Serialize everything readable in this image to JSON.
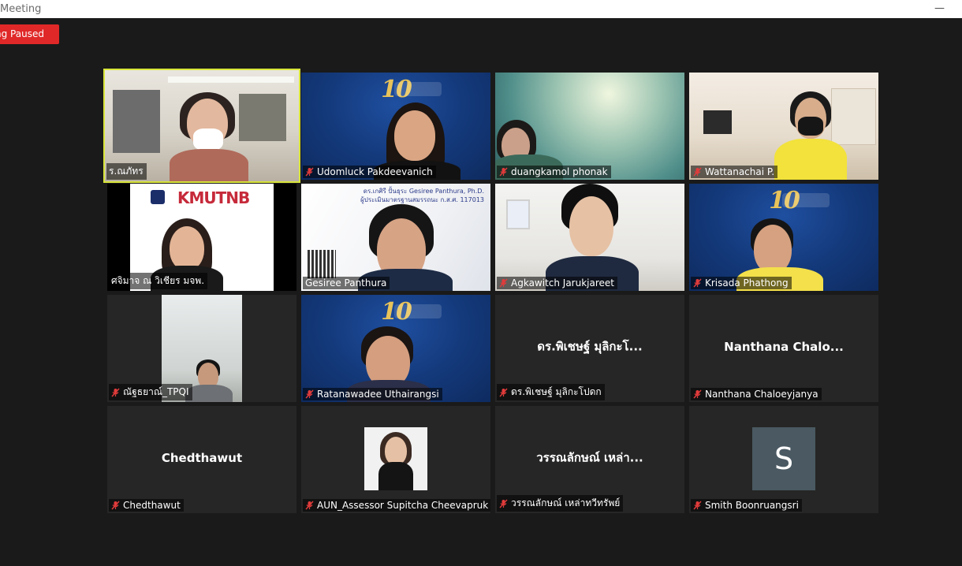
{
  "window": {
    "title": "Meeting",
    "minimize_label": "—"
  },
  "recording": {
    "label": "ng Paused"
  },
  "participants": [
    {
      "name": "ร.ณภัทร",
      "muted": false,
      "active": true
    },
    {
      "name": "Udomluck Pakdeevanich",
      "muted": true
    },
    {
      "name": "duangkamol phonak",
      "muted": true
    },
    {
      "name": "Wattanachai P.",
      "muted": true
    },
    {
      "name": "ศจิมาจ ณ วิเชียร มจพ.",
      "muted": false
    },
    {
      "name": "Gesiree Panthura",
      "muted": false
    },
    {
      "name": "Agkawitch Jarukjareet",
      "muted": true
    },
    {
      "name": "Krisada Phathong",
      "muted": true
    },
    {
      "name": "ณัฐธยาณ์_TPQI",
      "muted": true
    },
    {
      "name": "Ratanawadee Uthairangsi",
      "muted": true
    },
    {
      "name": "ดร.พิเชษฐ์ มุลิกะโปดก",
      "muted": true,
      "display": "ดร.พิเชษฐ์ มุลิกะโ..."
    },
    {
      "name": "Nanthana Chaloeyjanya",
      "muted": true,
      "display": "Nanthana  Chalo..."
    },
    {
      "name": "Chedthawut",
      "muted": true,
      "display": "Chedthawut"
    },
    {
      "name": "AUN_Assessor Supitcha Cheevapruk",
      "muted": true
    },
    {
      "name": "วรรณลักษณ์ เหล่าทวีทรัพย์",
      "muted": true,
      "display": "วรรณลักษณ์ เหล่า..."
    },
    {
      "name": "Smith Boonruangsri",
      "muted": true,
      "avatar_letter": "S"
    }
  ],
  "slides": {
    "kmutnb_logo": "KMUTNB",
    "doc_line1": "ดร.เกศิรี ปั้นธุระ Gesiree Panthura, Ph.D.",
    "doc_line2": "ผู้ประเมินมาตรฐานสมรรถนะ ก.ส.ศ. 117013",
    "anniversary_logo": "10"
  },
  "colors": {
    "active_border": "#d8e53a",
    "record_badge": "#e02828",
    "mute_icon": "#e23b3b",
    "avatar_bg": "#4a5962"
  }
}
